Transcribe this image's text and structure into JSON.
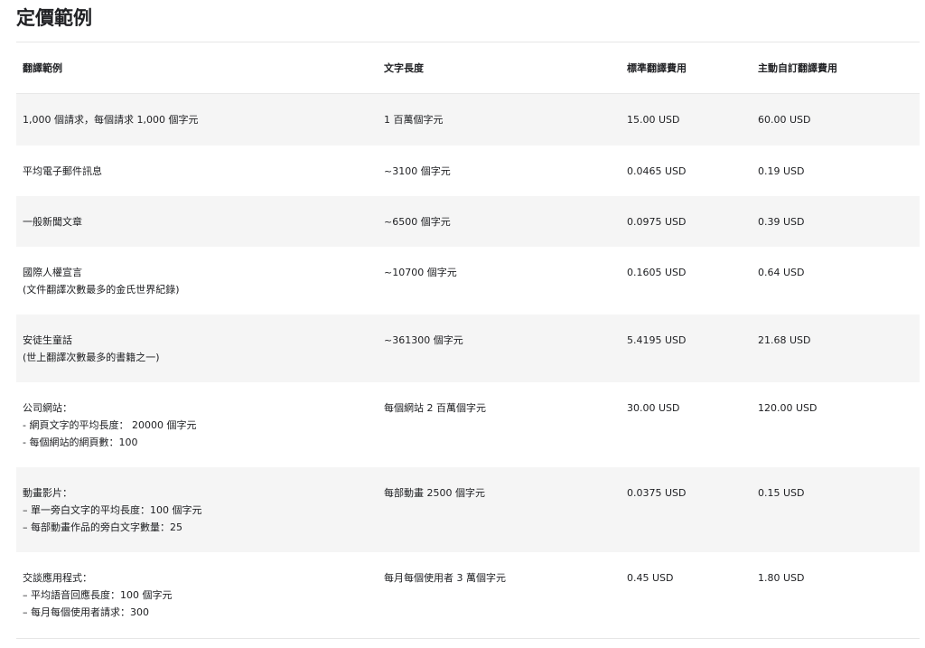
{
  "page": {
    "title": "定價範例"
  },
  "table": {
    "headers": [
      "翻譯範例",
      "文字長度",
      "標準翻譯費用",
      "主動自訂翻譯費用"
    ],
    "rows": [
      {
        "example": [
          "1,000 個請求，每個請求 1,000 個字元"
        ],
        "length": "1 百萬個字元",
        "standard": "15.00 USD",
        "custom": "60.00 USD"
      },
      {
        "example": [
          "平均電子郵件訊息"
        ],
        "length": "~3100 個字元",
        "standard": "0.0465 USD",
        "custom": "0.19 USD"
      },
      {
        "example": [
          "一般新聞文章"
        ],
        "length": "~6500 個字元",
        "standard": "0.0975 USD",
        "custom": "0.39 USD"
      },
      {
        "example": [
          "國際人權宣言",
          "(文件翻譯次數最多的金氏世界紀錄)"
        ],
        "length": "~10700 個字元",
        "standard": "0.1605 USD",
        "custom": "0.64 USD"
      },
      {
        "example": [
          "安徒生童話",
          "(世上翻譯次數最多的書籍之一)"
        ],
        "length": "~361300 個字元",
        "standard": "5.4195 USD",
        "custom": "21.68 USD"
      },
      {
        "example": [
          "公司網站：",
          "-   網頁文字的平均長度： 20000 個字元",
          "-   每個網站的網頁數：100"
        ],
        "length": "每個網站 2 百萬個字元",
        "standard": "30.00 USD",
        "custom": "120.00 USD"
      },
      {
        "example": [
          "動畫影片：",
          "–   單一旁白文字的平均長度：100 個字元",
          "–   每部動畫作品的旁白文字數量：25"
        ],
        "length": "每部動畫 2500 個字元",
        "standard": "0.0375 USD",
        "custom": "0.15 USD"
      },
      {
        "example": [
          "交談應用程式：",
          "–   平均語音回應長度：100 個字元",
          "–   每月每個使用者請求：300"
        ],
        "length": "每月每個使用者 3 萬個字元",
        "standard": "0.45 USD",
        "custom": "1.80 USD"
      }
    ]
  }
}
